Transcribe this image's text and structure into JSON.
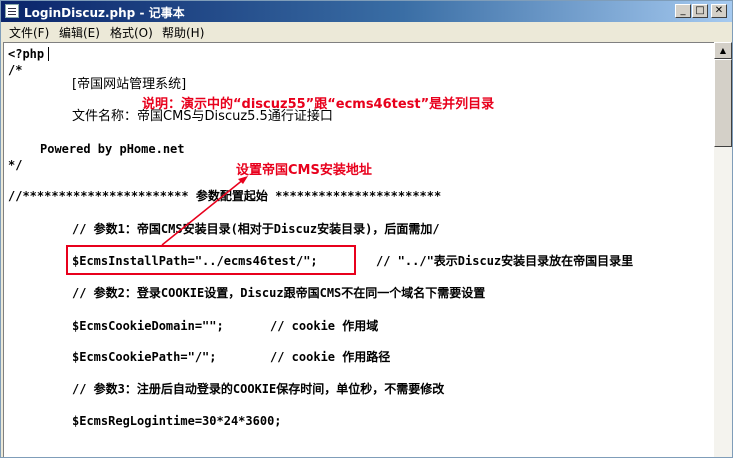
{
  "window": {
    "title": "LoginDiscuz.php - 记事本",
    "min_icon": "minimize-icon",
    "max_icon": "maximize-icon",
    "close_icon": "close-icon"
  },
  "menu": [
    {
      "label": "文件(F)"
    },
    {
      "label": "编辑(E)"
    },
    {
      "label": "格式(O)"
    },
    {
      "label": "帮助(H)"
    }
  ],
  "editor": {
    "lines": [
      "<?php",
      "/*",
      "[帝国网站管理系统]",
      "文件名称：帝国CMS与Discuz5.5通行证接口",
      "Powered by pHome.net",
      "*/",
      "//*********************** 参数配置起始 ***********************",
      "// 参数1：帝国CMS安装目录(相对于Discuz安装目录)，后面需加/",
      "$EcmsInstallPath=\"../ecms46test/\";",
      "// \"../\"表示Discuz安装目录放在帝国目录里",
      "// 参数2：登录COOKIE设置，Discuz跟帝国CMS不在同一个域名下需要设置",
      "$EcmsCookieDomain=\"\";",
      "// cookie 作用域",
      "$EcmsCookiePath=\"/\";",
      "// cookie 作用路径",
      "// 参数3：注册后自动登录的COOKIE保存时间，单位秒，不需要修改",
      "$EcmsRegLogintime=30*24*3600;"
    ]
  },
  "annotations": {
    "note": "说明：演示中的“discuz55”跟“ecms46test”是并列目录",
    "label": "设置帝国CMS安装地址",
    "color": "#e8001c"
  },
  "scrollbar": {
    "up_icon": "scroll-up-icon"
  }
}
